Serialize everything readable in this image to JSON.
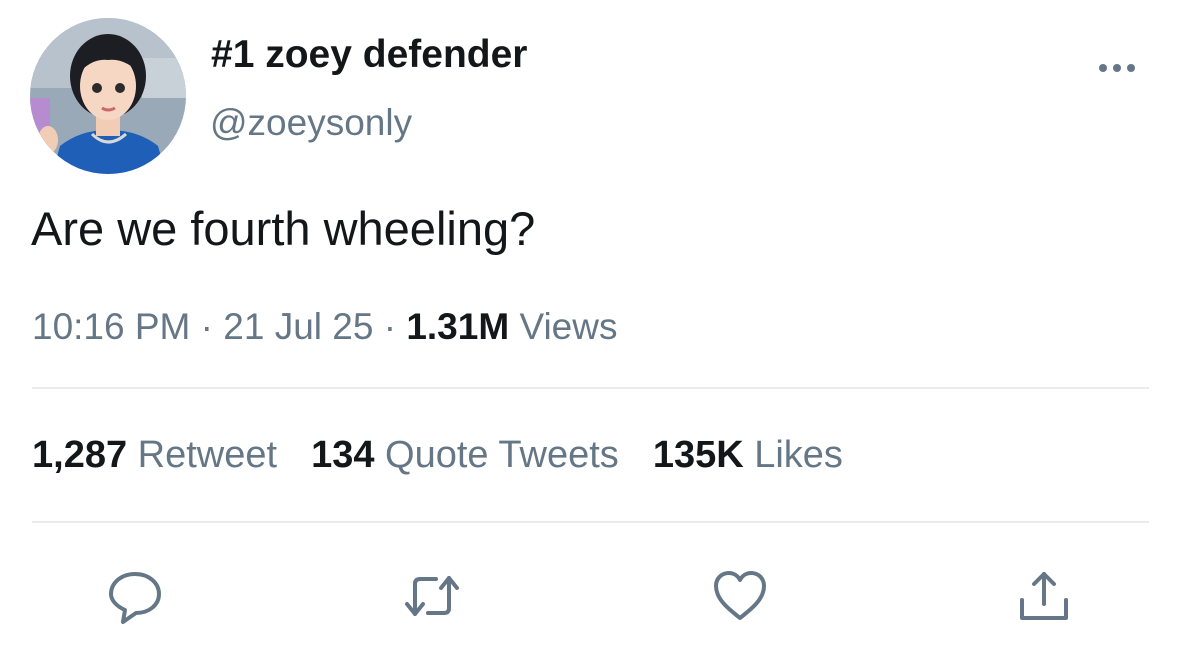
{
  "user": {
    "display_name": "#1 zoey defender",
    "handle": "@zoeysonly"
  },
  "tweet": {
    "text": "Are we fourth wheeling?",
    "time": "10:16 PM",
    "separator": " · ",
    "date": "21 Jul 25",
    "views_count": "1.31M",
    "views_label": "Views"
  },
  "stats": {
    "retweets_count": "1,287",
    "retweets_label": "Retweet",
    "quotes_count": "134",
    "quotes_label": "Quote Tweets",
    "likes_count": "135K",
    "likes_label": "Likes"
  },
  "icons": {
    "more": "more-horizontal-icon",
    "reply": "reply-icon",
    "retweet": "retweet-icon",
    "like": "heart-icon",
    "share": "share-icon"
  },
  "colors": {
    "text_primary": "#14171a",
    "text_secondary": "#657786",
    "icon": "#657786",
    "divider": "#e6ecf0"
  }
}
